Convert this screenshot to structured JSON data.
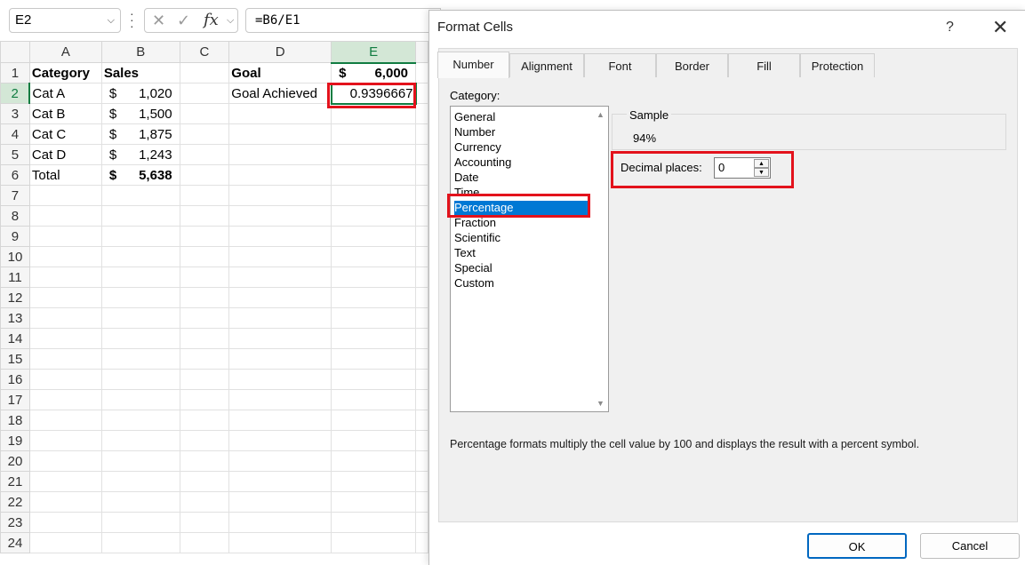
{
  "formula_bar": {
    "name_box": "E2",
    "cancel_glyph": "✕",
    "enter_glyph": "✓",
    "fx_glyph": "fx",
    "formula": "=B6/E1"
  },
  "sheet": {
    "columns": [
      "A",
      "B",
      "C",
      "D",
      "E"
    ],
    "rows": [
      "1",
      "2",
      "3",
      "4",
      "5",
      "6",
      "7",
      "8",
      "9",
      "10",
      "11",
      "12",
      "13",
      "14",
      "15",
      "16",
      "17",
      "18",
      "19",
      "20",
      "21",
      "22",
      "23",
      "24"
    ],
    "cells": {
      "A1": "Category",
      "B1": "Sales",
      "D1": "Goal",
      "E1_sym": "$",
      "E1_val": "6,000",
      "A2": "Cat A",
      "B2_sym": "$",
      "B2_val": "1,020",
      "D2": "Goal Achieved",
      "E2": "0.9396667",
      "A3": "Cat B",
      "B3_sym": "$",
      "B3_val": "1,500",
      "A4": "Cat C",
      "B4_sym": "$",
      "B4_val": "1,875",
      "A5": "Cat D",
      "B5_sym": "$",
      "B5_val": "1,243",
      "A6": "Total",
      "B6_sym": "$",
      "B6_val": "5,638"
    },
    "selected_cell": "E2"
  },
  "dialog": {
    "title": "Format Cells",
    "help": "?",
    "close": "✕",
    "tabs": [
      "Number",
      "Alignment",
      "Font",
      "Border",
      "Fill",
      "Protection"
    ],
    "active_tab": "Number",
    "category_label": "Category:",
    "categories": [
      "General",
      "Number",
      "Currency",
      "Accounting",
      "Date",
      "Time",
      "Percentage",
      "Fraction",
      "Scientific",
      "Text",
      "Special",
      "Custom"
    ],
    "selected_category": "Percentage",
    "sample_label": "Sample",
    "sample_value": "94%",
    "decimal_label": "Decimal places:",
    "decimal_value": "0",
    "description": "Percentage formats multiply the cell value by 100 and displays the result with a percent symbol.",
    "ok_label": "OK",
    "cancel_label": "Cancel"
  },
  "colors": {
    "accent_green": "#107c41",
    "selection_blue": "#0078d4",
    "highlight_red": "#e3121c"
  }
}
